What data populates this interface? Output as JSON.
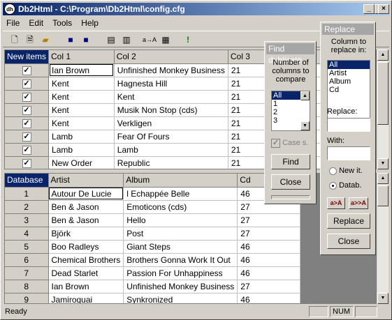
{
  "window": {
    "title": "Db2Html - C:\\Program\\Db2Html\\config.cfg",
    "icon_text": "dh"
  },
  "menu": [
    "File",
    "Edit",
    "Tools",
    "Help"
  ],
  "top_grid": {
    "corner": "New items",
    "columns": [
      "Col 1",
      "Col 2",
      "Col 3"
    ],
    "rows": [
      {
        "c1": "Ian Brown",
        "c2": "Unfinished Monkey Business",
        "c3": "21"
      },
      {
        "c1": "Kent",
        "c2": "Hagnesta Hill",
        "c3": "21"
      },
      {
        "c1": "Kent",
        "c2": "Kent",
        "c3": "21"
      },
      {
        "c1": "Kent",
        "c2": "Musik Non Stop (cds)",
        "c3": "21"
      },
      {
        "c1": "Kent",
        "c2": "Verkligen",
        "c3": "21"
      },
      {
        "c1": "Lamb",
        "c2": "Fear Of Fours",
        "c3": "21"
      },
      {
        "c1": "Lamb",
        "c2": "Lamb",
        "c3": "21"
      },
      {
        "c1": "New Order",
        "c2": "Republic",
        "c3": "21"
      }
    ]
  },
  "bottom_grid": {
    "corner": "Database",
    "columns": [
      "Artist",
      "Album",
      "Cd"
    ],
    "rows": [
      {
        "n": "1",
        "c1": "Autour De Lucie",
        "c2": "l Echappée Belle",
        "c3": "46"
      },
      {
        "n": "2",
        "c1": "Ben & Jason",
        "c2": "Emoticons (cds)",
        "c3": "27"
      },
      {
        "n": "3",
        "c1": "Ben & Jason",
        "c2": "Hello",
        "c3": "27"
      },
      {
        "n": "4",
        "c1": "Björk",
        "c2": "Post",
        "c3": "27"
      },
      {
        "n": "5",
        "c1": "Boo Radleys",
        "c2": "Giant Steps",
        "c3": "46"
      },
      {
        "n": "6",
        "c1": "Chemical Brothers",
        "c2": "Brothers Gonna Work It Out",
        "c3": "46"
      },
      {
        "n": "7",
        "c1": "Dead Starlet",
        "c2": "Passion For Unhappiness",
        "c3": "46"
      },
      {
        "n": "8",
        "c1": "Ian Brown",
        "c2": "Unfinished Monkey Business",
        "c3": "27"
      },
      {
        "n": "9",
        "c1": "Jamiroquai",
        "c2": "Synkronized",
        "c3": "46"
      }
    ]
  },
  "find_dialog": {
    "title": "Find dublicate",
    "label": "Number of columns to compare",
    "options": [
      "All",
      "1",
      "2",
      "3"
    ],
    "case_label": "Case s.",
    "find_button": "Find",
    "close_button": "Close"
  },
  "replace_dialog": {
    "title": "Replace",
    "column_label": "Column to replace in:",
    "columns": [
      "All",
      "Artist",
      "Album",
      "Cd"
    ],
    "replace_label": "Replace:",
    "with_label": "With:",
    "radio_new": "New it.",
    "radio_db": "Datab.",
    "case_lower_button": "a>A",
    "case_upper_button": "a>>A",
    "replace_button": "Replace",
    "close_button": "Close"
  },
  "status": {
    "text": "Ready",
    "num": "NUM"
  }
}
